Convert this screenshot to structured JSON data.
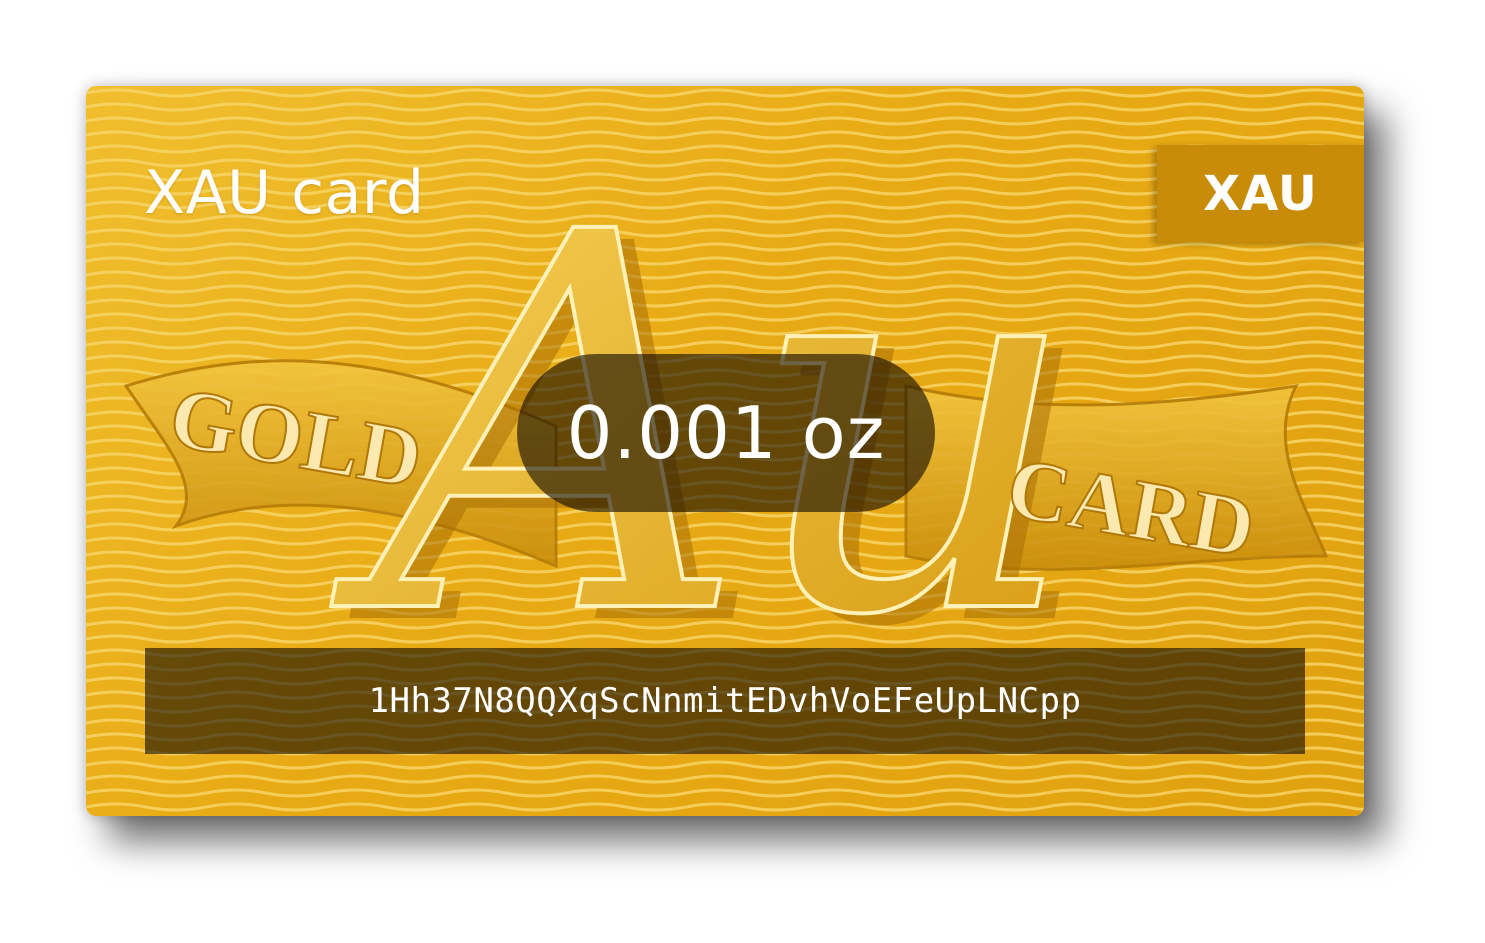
{
  "card": {
    "title": "XAU card",
    "currency_code": "XAU",
    "amount": "0.001 oz",
    "address": "1Hh37N8QQXqScNnmitEDvhVoEFeUpLNCpp"
  },
  "artwork": {
    "monogram": "Au",
    "ribbon_left": "GOLD",
    "ribbon_right": "CARD"
  },
  "colors": {
    "card_gold": "#e8aa14",
    "badge_gold": "#c98c08",
    "overlay_dark": "rgba(20,12,0,0.62)"
  }
}
